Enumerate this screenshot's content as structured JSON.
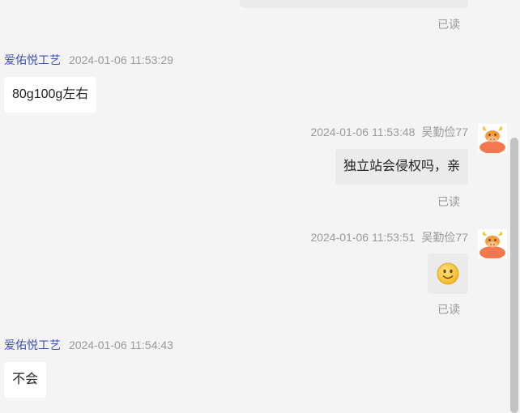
{
  "messages": [
    {
      "kind": "outgoing-cropped",
      "read_label": "已读"
    },
    {
      "kind": "incoming",
      "sender": "爱佑悦工艺",
      "time": "2024-01-06 11:53:29",
      "text": "80g100g左右"
    },
    {
      "kind": "outgoing",
      "sender": "吴勤俭77",
      "time": "2024-01-06 11:53:48",
      "text": "独立站会侵权吗，亲",
      "read_label": "已读"
    },
    {
      "kind": "outgoing-emoji",
      "sender": "吴勤俭77",
      "time": "2024-01-06 11:53:51",
      "emoji": "slightly-smiling-face",
      "read_label": "已读"
    },
    {
      "kind": "incoming",
      "sender": "爱佑悦工艺",
      "time": "2024-01-06 11:54:43",
      "text": "不会"
    }
  ],
  "colors": {
    "background": "#f4f4f4",
    "incoming_bubble": "#ffffff",
    "outgoing_bubble": "#ebebeb",
    "sender_name": "#3f51b5",
    "meta_text": "#9a9a9a"
  }
}
